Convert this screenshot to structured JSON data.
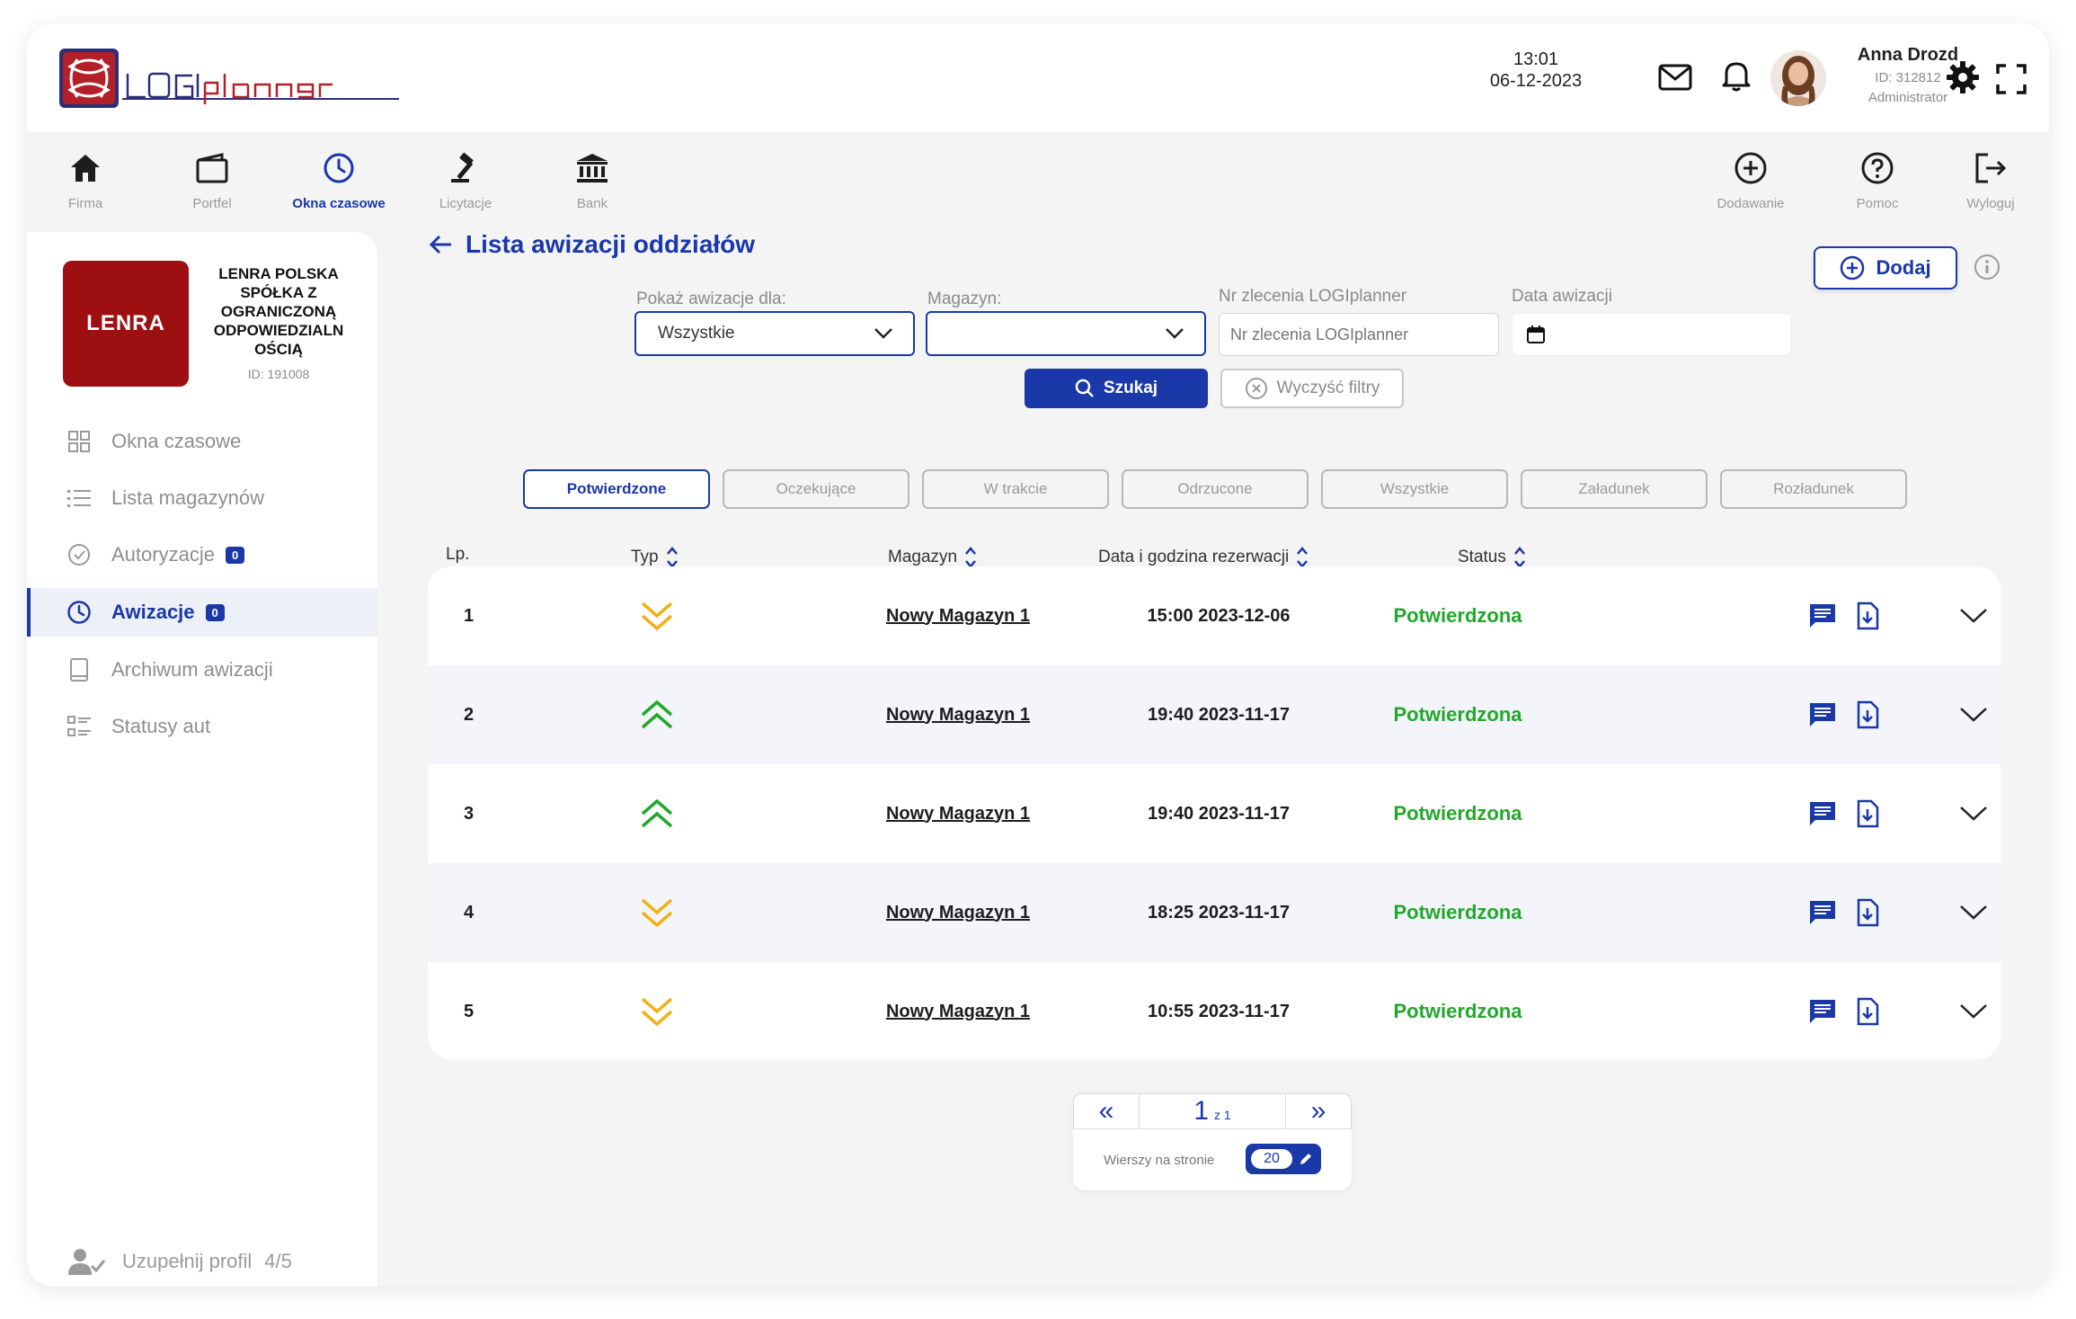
{
  "header": {
    "logo_text": "LOGIplanner",
    "time": "13:01",
    "date": "06-12-2023",
    "user": {
      "name": "Anna Drozd",
      "id": "ID: 312812",
      "role": "Administrator"
    }
  },
  "nav": {
    "left": [
      {
        "label": "Firma",
        "icon": "home-icon"
      },
      {
        "label": "Portfel",
        "icon": "wallet-icon"
      },
      {
        "label": "Okna czasowe",
        "icon": "clock-icon",
        "active": true
      },
      {
        "label": "Licytacje",
        "icon": "gavel-icon"
      },
      {
        "label": "Bank",
        "icon": "bank-icon"
      }
    ],
    "right": [
      {
        "label": "Dodawanie",
        "icon": "plus-circle-icon"
      },
      {
        "label": "Pomoc",
        "icon": "help-circle-icon"
      },
      {
        "label": "Wyloguj",
        "icon": "logout-icon"
      }
    ]
  },
  "company": {
    "logo_text": "LENRA",
    "name": "LENRA POLSKA SPÓŁKA Z OGRANICZONĄ ODPOWIEDZIALN OŚCIĄ",
    "id": "ID: 191008"
  },
  "sidebar": {
    "items": [
      {
        "label": "Okna czasowe",
        "icon": "grid-icon"
      },
      {
        "label": "Lista magazynów",
        "icon": "list-icon"
      },
      {
        "label": "Autoryzacje",
        "icon": "check-circle-icon",
        "badge": "0"
      },
      {
        "label": "Awizacje",
        "icon": "clock-icon",
        "badge": "0",
        "active": true
      },
      {
        "label": "Archiwum awizacji",
        "icon": "tablet-icon"
      },
      {
        "label": "Statusy aut",
        "icon": "checklist-icon"
      }
    ],
    "profile": {
      "label": "Uzupełnij profil",
      "progress": "4/5"
    }
  },
  "main": {
    "title": "Lista awizacji oddziałów",
    "add_label": "Dodaj",
    "filters": {
      "show_for_label": "Pokaż awizacje dla:",
      "show_for_value": "Wszystkie",
      "warehouse_label": "Magazyn:",
      "warehouse_value": "",
      "order_label": "Nr zlecenia LOGIplanner",
      "order_placeholder": "Nr zlecenia LOGIplanner",
      "date_label": "Data awizacji",
      "search_label": "Szukaj",
      "clear_label": "Wyczyść filtry"
    },
    "tabs": [
      {
        "label": "Potwierdzone",
        "active": true
      },
      {
        "label": "Oczekujące"
      },
      {
        "label": "W trakcie"
      },
      {
        "label": "Odrzucone"
      },
      {
        "label": "Wszystkie"
      },
      {
        "label": "Załadunek"
      },
      {
        "label": "Rozładunek"
      }
    ],
    "columns": {
      "lp": "Lp.",
      "type": "Typ",
      "warehouse": "Magazyn",
      "datetime": "Data i godzina rezerwacji",
      "status": "Status"
    },
    "rows": [
      {
        "lp": "1",
        "type": "unloading",
        "warehouse": "Nowy Magazyn 1",
        "datetime": "15:00 2023-12-06",
        "status": "Potwierdzona"
      },
      {
        "lp": "2",
        "type": "loading",
        "warehouse": "Nowy Magazyn 1",
        "datetime": "19:40 2023-11-17",
        "status": "Potwierdzona"
      },
      {
        "lp": "3",
        "type": "loading",
        "warehouse": "Nowy Magazyn 1",
        "datetime": "19:40 2023-11-17",
        "status": "Potwierdzona"
      },
      {
        "lp": "4",
        "type": "unloading",
        "warehouse": "Nowy Magazyn 1",
        "datetime": "18:25 2023-11-17",
        "status": "Potwierdzona"
      },
      {
        "lp": "5",
        "type": "unloading",
        "warehouse": "Nowy Magazyn 1",
        "datetime": "10:55 2023-11-17",
        "status": "Potwierdzona"
      }
    ],
    "pagination": {
      "prev": "«",
      "next": "»",
      "current": "1",
      "of": "z 1",
      "rows_label": "Wierszy na stronie",
      "rows_value": "20"
    }
  },
  "colors": {
    "accent": "#1a38a8",
    "status_ok": "#21a82a",
    "loading_arrow": "#21a82a",
    "unloading_arrow": "#f0b21a",
    "company_logo": "#9e0f12"
  }
}
